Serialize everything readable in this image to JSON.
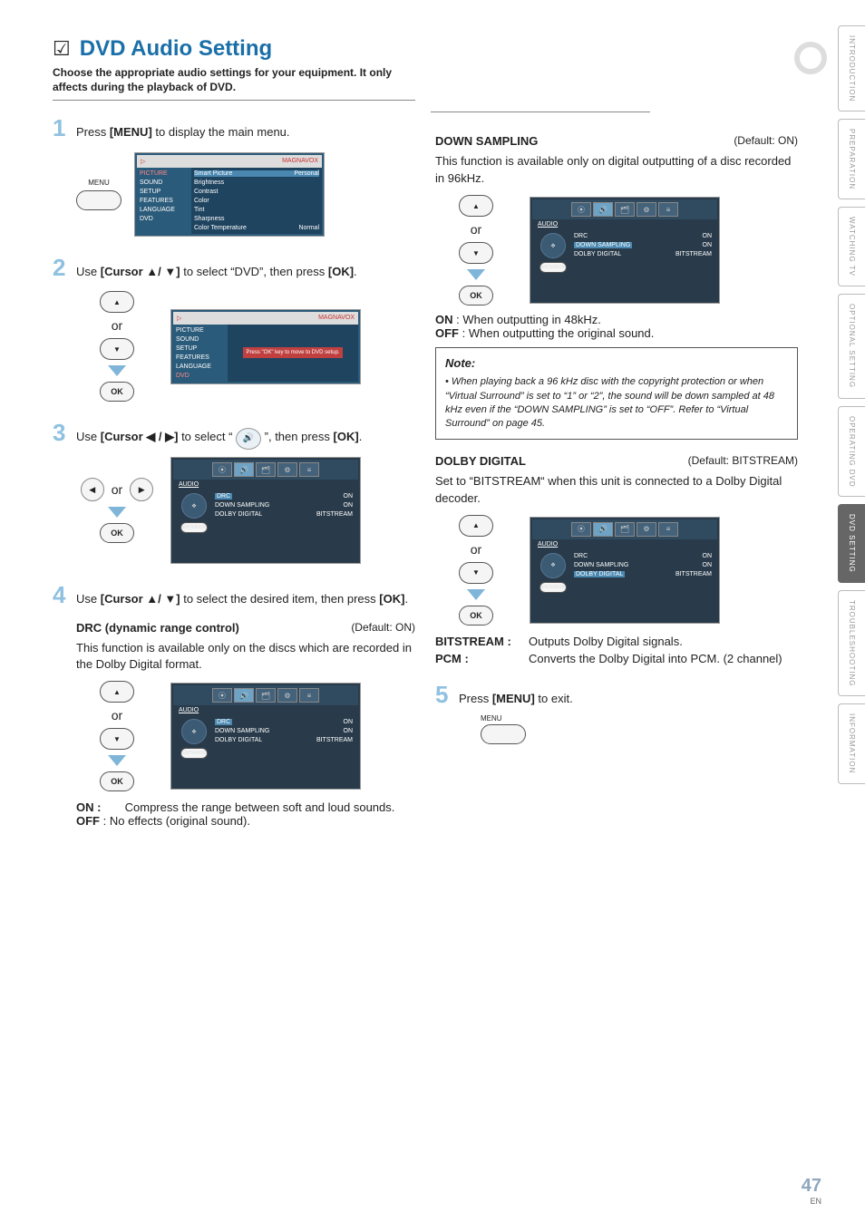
{
  "sideTabs": [
    "INTRODUCTION",
    "PREPARATION",
    "WATCHING TV",
    "OPTIONAL SETTING",
    "OPERATING DVD",
    "DVD SETTING",
    "TROUBLESHOOTING",
    "INFORMATION"
  ],
  "activeSideTab": 5,
  "pageNumber": "47",
  "pageSuffix": "EN",
  "checkGlyph": "☑",
  "title": "DVD Audio Setting",
  "subtitle": "Choose the appropriate audio settings for your equipment. It only affects during the playback of DVD.",
  "glyph": {
    "up": "▲",
    "down": "▼",
    "left": "◀",
    "right": "▶",
    "audio": "🔊"
  },
  "steps": {
    "s1": {
      "num": "1",
      "pre": "Press ",
      "bold": "[MENU]",
      "post": " to display the main menu."
    },
    "s2": {
      "num": "2",
      "pre": "Use ",
      "bold": "[Cursor ▲/ ▼]",
      "mid": " to select “DVD”, then press ",
      "bold2": "[OK]",
      "post": "."
    },
    "s3": {
      "num": "3",
      "pre": "Use ",
      "bold": "[Cursor ◀ / ▶]",
      "mid": " to select “ ",
      "post": " ”, then press ",
      "bold2": "[OK]",
      "post2": "."
    },
    "s4": {
      "num": "4",
      "pre": "Use ",
      "bold": "[Cursor ▲/ ▼]",
      "mid": " to select the desired item, then press ",
      "bold2": "[OK]",
      "post": "."
    },
    "s5": {
      "num": "5",
      "pre": "Press ",
      "bold": "[MENU]",
      "post": " to exit."
    }
  },
  "labels": {
    "menu": "MENU",
    "ok": "OK",
    "or": "or",
    "enterOk": "ENTER/OK"
  },
  "tv1": {
    "brand": "MAGNAVOX",
    "nav": [
      "PICTURE",
      "SOUND",
      "SETUP",
      "FEATURES",
      "LANGUAGE",
      "DVD"
    ],
    "sel": 0,
    "rows": [
      [
        "Smart Picture",
        "Personal"
      ],
      [
        "Brightness",
        ""
      ],
      [
        "Contrast",
        ""
      ],
      [
        "Color",
        ""
      ],
      [
        "Tint",
        ""
      ],
      [
        "Sharpness",
        ""
      ],
      [
        "Color Temperature",
        "Normal"
      ]
    ]
  },
  "tv2": {
    "brand": "MAGNAVOX",
    "nav": [
      "PICTURE",
      "SOUND",
      "SETUP",
      "FEATURES",
      "LANGUAGE",
      "DVD"
    ],
    "sel": 5,
    "msg": "Press \"OK\" key to move to DVD setup."
  },
  "audioScreen": {
    "title": "AUDIO",
    "drc": {
      "label": "DRC",
      "value": "ON"
    },
    "down": {
      "label": "DOWN SAMPLING",
      "value": "ON"
    },
    "dolby": {
      "label": "DOLBY DIGITAL",
      "value": "BITSTREAM"
    }
  },
  "drc": {
    "heading": "DRC (dynamic range control)",
    "default": "(Default: ON)",
    "desc": "This function is available only on the discs which are recorded in the Dolby Digital format.",
    "onLabel": "ON :",
    "onText": "Compress the range between soft and loud sounds.",
    "offLabel": "OFF",
    "offText": ": No effects (original sound)."
  },
  "downSampling": {
    "heading": "DOWN SAMPLING",
    "default": "(Default: ON)",
    "desc": "This function is available only on digital outputting of a disc recorded in 96kHz.",
    "onLabel": "ON",
    "onText": ": When outputting in 48kHz.",
    "offLabel": "OFF",
    "offText": ": When outputting the original sound.",
    "note": {
      "title": "Note:",
      "text": "• When playing back a 96 kHz disc with the copyright protection or when “Virtual Surround” is set to “1” or “2”, the sound will be down sampled at 48 kHz even if the “DOWN SAMPLING” is set to “OFF”.  Refer to “Virtual Surround” on page 45."
    }
  },
  "dolby": {
    "heading": "DOLBY DIGITAL",
    "default": "(Default: BITSTREAM)",
    "desc": "Set to “BITSTREAM“ when this unit is connected to a Dolby Digital decoder.",
    "bitLabel": "BITSTREAM :",
    "bitText": "Outputs Dolby Digital signals.",
    "pcmLabel": "PCM :",
    "pcmText": "Converts the Dolby Digital into PCM. (2 channel)"
  }
}
